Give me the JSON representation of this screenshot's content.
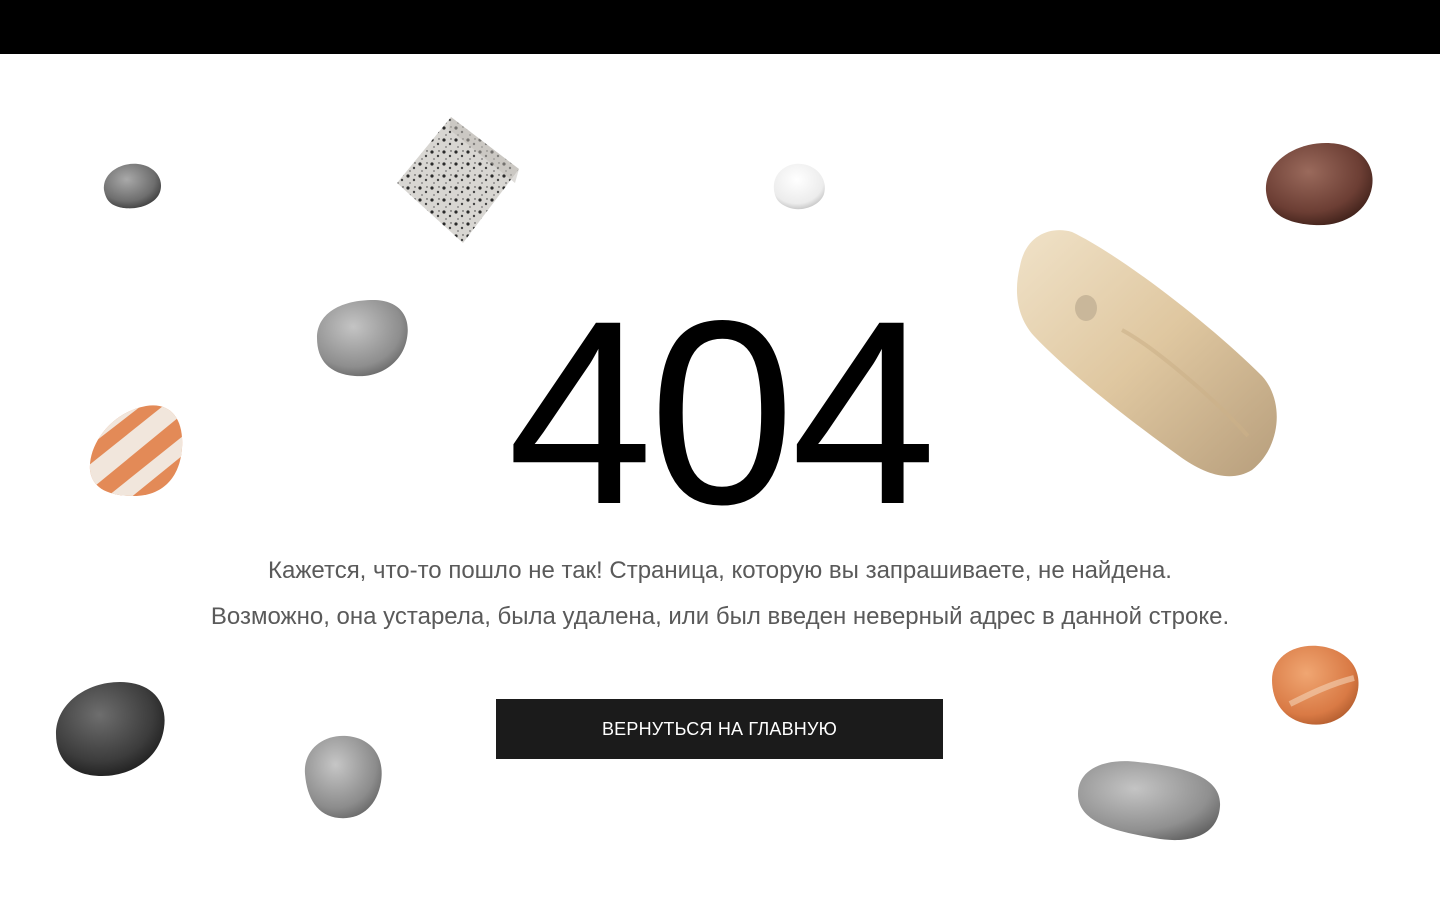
{
  "error": {
    "code": "404"
  },
  "message": {
    "line1": "Кажется, что-то пошло не так! Страница, которую вы запрашиваете, не найдена.",
    "line2": "Возможно, она устарела, была удалена, или был введен неверный адрес в данной строке."
  },
  "actions": {
    "home_label": "ВЕРНУТЬСЯ НА ГЛАВНУЮ"
  },
  "colors": {
    "topbar": "#000000",
    "button_bg": "#1b1b1b",
    "button_text": "#ffffff",
    "message_text": "#5a5a5a"
  }
}
